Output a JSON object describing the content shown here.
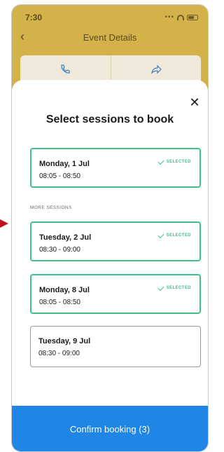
{
  "status_bar": {
    "time": "7:30"
  },
  "header": {
    "title": "Event Details"
  },
  "sheet": {
    "title": "Select sessions to book",
    "more_sessions_label": "MORE SESSIONS",
    "selected_label": "SELECTED",
    "sessions": [
      {
        "date": "Monday, 1 Jul",
        "time": "08:05 - 08:50",
        "selected": true
      },
      {
        "date": "Tuesday, 2 Jul",
        "time": "08:30 - 09:00",
        "selected": true
      },
      {
        "date": "Monday, 8 Jul",
        "time": "08:05 - 08:50",
        "selected": true
      },
      {
        "date": "Tuesday, 9 Jul",
        "time": "08:30 - 09:00",
        "selected": false
      }
    ]
  },
  "footer": {
    "confirm_label": "Confirm booking (3)"
  },
  "colors": {
    "accent_green": "#3fbf8a",
    "primary_blue": "#1f86e5",
    "header_gold": "#d4b24a",
    "annotation_red": "#c0121b"
  }
}
